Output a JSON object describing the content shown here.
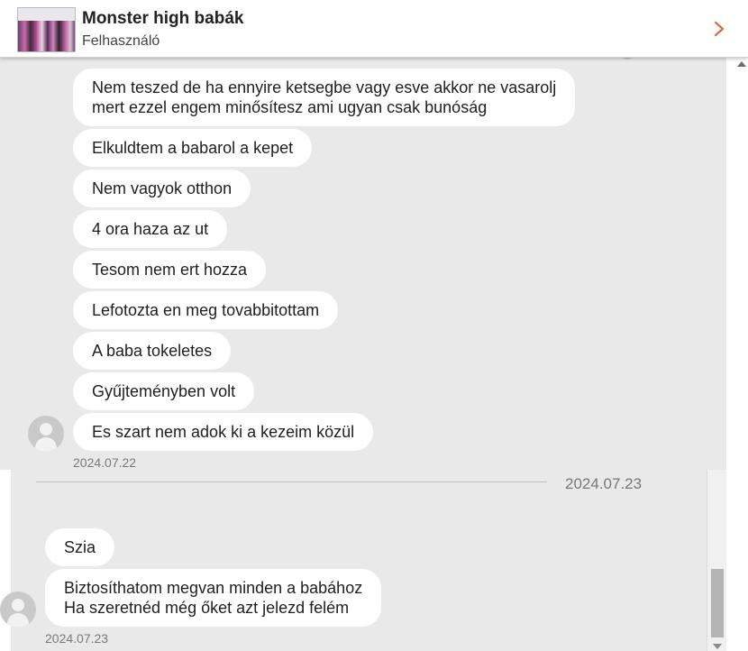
{
  "header": {
    "title": "Monster high babák",
    "subtitle": "Felhasználó",
    "thumbnail_icon": "product-thumbnail",
    "chevron_icon": "chevron-right-icon",
    "accent_color": "#e0683a"
  },
  "messages_group_1": [
    {
      "lines": [
        "Nem teszed de ha ennyire ketsegbe vagy esve akkor ne vasarolj",
        "mert ezzel engem minősítesz ami ugyan csak bunóság"
      ]
    },
    {
      "lines": [
        "Elkuldtem a babarol a kepet"
      ]
    },
    {
      "lines": [
        "Nem vagyok otthon"
      ]
    },
    {
      "lines": [
        "4 ora haza az ut"
      ]
    },
    {
      "lines": [
        "Tesom nem ert hozza"
      ]
    },
    {
      "lines": [
        "Lefotozta en meg tovabbitottam"
      ]
    },
    {
      "lines": [
        "A baba tokeletes"
      ]
    },
    {
      "lines": [
        "Gyűjteményben volt"
      ]
    },
    {
      "lines": [
        "Es szart nem adok ki a kezeim közül"
      ]
    }
  ],
  "group_1_timestamp": "2024.07.22",
  "date_divider": "2024.07.23",
  "messages_group_2": [
    {
      "lines": [
        "Szia"
      ]
    },
    {
      "lines": [
        "Biztosíthatom megvan minden a babához",
        "Ha szeretnéd még őket azt jelezd felém"
      ]
    }
  ],
  "group_2_timestamp": "2024.07.23"
}
